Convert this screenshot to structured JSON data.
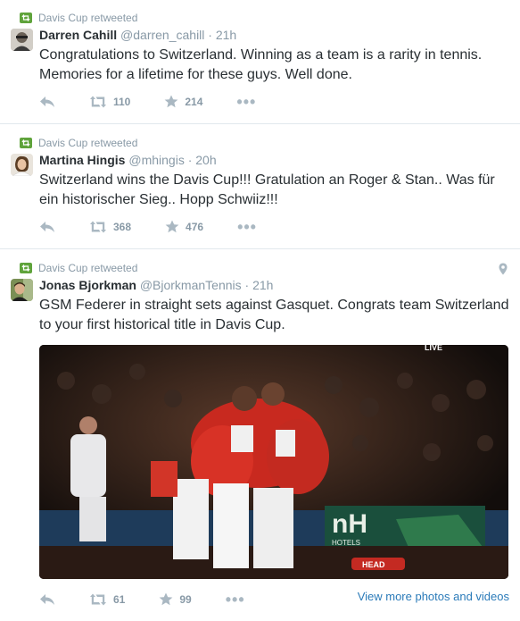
{
  "tweets": [
    {
      "retweeted_by": "Davis Cup retweeted",
      "name": "Darren Cahill",
      "handle": "@darren_cahill",
      "dot": "·",
      "time": "21h",
      "text": "Congratulations to Switzerland. Winning as a team is a rarity in tennis. Memories for a lifetime for these guys. Well done.",
      "retweets": "110",
      "favorites": "214"
    },
    {
      "retweeted_by": "Davis Cup retweeted",
      "name": "Martina Hingis",
      "handle": "@mhingis",
      "dot": "·",
      "time": "20h",
      "text": "Switzerland wins the Davis Cup!!! Gratulation an Roger & Stan.. Was für ein historischer Sieg.. Hopp Schwiiz!!!",
      "retweets": "368",
      "favorites": "476"
    },
    {
      "retweeted_by": "Davis Cup retweeted",
      "name": "Jonas Bjorkman",
      "handle": "@BjorkmanTennis",
      "dot": "·",
      "time": "21h",
      "text": "GSM Federer in straight sets against Gasquet. Congrats team Switzerland to your first historical title in Davis Cup.",
      "retweets": "61",
      "favorites": "99",
      "view_more": "View more photos and videos",
      "media": {
        "live_label": "LIVE",
        "sponsor_top": "nH",
        "sponsor_bottom": "HOTELS",
        "racket_label": "HEAD"
      }
    }
  ],
  "colors": {
    "retweet_green": "#5fa33b",
    "link_blue": "#2b7bb9",
    "muted": "#8899a6",
    "text": "#292f33"
  },
  "icons": [
    "retweet-icon",
    "reply-icon",
    "favorite-star-icon",
    "more-dots-icon",
    "location-pin-icon"
  ]
}
